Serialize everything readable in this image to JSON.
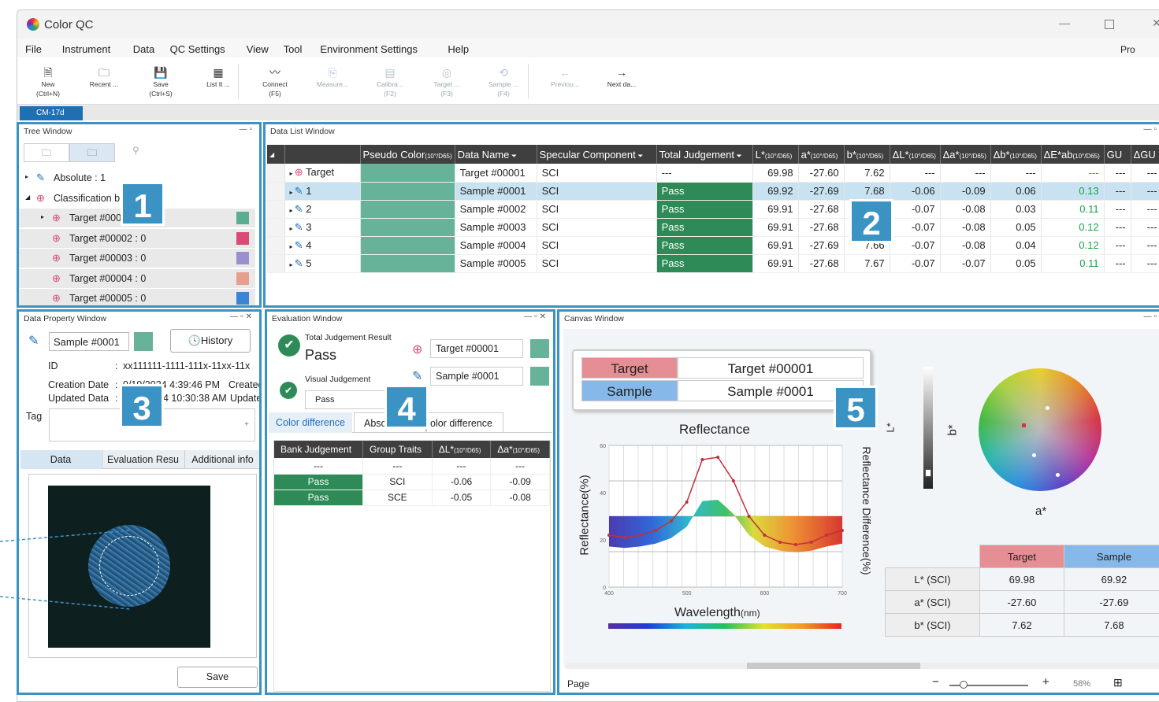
{
  "app": {
    "title": "Color QC",
    "pro_label": "Pro"
  },
  "menu": [
    "File",
    "Instrument",
    "Data",
    "QC Settings",
    "View",
    "Tool",
    "Environment Settings",
    "Help"
  ],
  "toolbar": [
    {
      "label": "New",
      "sub": "(Ctrl+N)",
      "icon": "new-file-icon",
      "glyph": "🗎",
      "enabled": true
    },
    {
      "label": "Recent ...",
      "sub": "",
      "icon": "recent-icon",
      "glyph": "🗀",
      "enabled": true
    },
    {
      "label": "Save",
      "sub": "(Ctrl+S)",
      "icon": "save-icon",
      "glyph": "💾",
      "enabled": true
    },
    {
      "label": "List It ...",
      "sub": "",
      "icon": "list-icon",
      "glyph": "▦",
      "enabled": true
    },
    {
      "label": "Connect",
      "sub": "(F5)",
      "icon": "connect-icon",
      "glyph": "〰",
      "enabled": true
    },
    {
      "label": "Measure...",
      "sub": "",
      "icon": "measure-icon",
      "glyph": "⎘",
      "enabled": false
    },
    {
      "label": "Calibra...",
      "sub": "(F2)",
      "icon": "calibrate-icon",
      "glyph": "▤",
      "enabled": false
    },
    {
      "label": "Target ...",
      "sub": "(F3)",
      "icon": "target-measure-icon",
      "glyph": "◎",
      "enabled": false
    },
    {
      "label": "Sample ...",
      "sub": "(F4)",
      "icon": "sample-measure-icon",
      "glyph": "⟲",
      "enabled": false
    },
    {
      "label": "Previou...",
      "sub": "",
      "icon": "previous-icon",
      "glyph": "←",
      "enabled": false
    },
    {
      "label": "Next da...",
      "sub": "",
      "icon": "next-icon",
      "glyph": "→",
      "enabled": true
    }
  ],
  "doc_tab": "CM-17d",
  "tree": {
    "title": "Tree Window",
    "rows": [
      {
        "label": "Absolute : 1",
        "icon": "probe-icon",
        "color": ""
      },
      {
        "label": "Classification b",
        "icon": "target-icon",
        "color": ""
      },
      {
        "label": "Target #000",
        "icon": "target-icon",
        "color": "#5aad8f"
      },
      {
        "label": "Target #00002 : 0",
        "icon": "target-icon",
        "color": "#d94a75"
      },
      {
        "label": "Target #00003 : 0",
        "icon": "target-icon",
        "color": "#9a8fcf"
      },
      {
        "label": "Target #00004 : 0",
        "icon": "target-icon",
        "color": "#e6a08f"
      },
      {
        "label": "Target #00005 : 0",
        "icon": "target-icon",
        "color": "#3a86d4"
      }
    ]
  },
  "datalist": {
    "title": "Data List Window",
    "headers": [
      "Pseudo Color",
      "Data Name",
      "Specular Component",
      "Total Judgement",
      "L*",
      "a*",
      "b*",
      "ΔL*",
      "Δa*",
      "Δb*",
      "ΔE*ab",
      "GU",
      "ΔGU"
    ],
    "illum": "(10°/D65)",
    "rows": [
      {
        "name": "Target #00001",
        "idx": "Target",
        "spec": "SCI",
        "judge": "---",
        "L": "69.98",
        "a": "-27.60",
        "b": "7.62",
        "dL": "---",
        "da": "---",
        "db": "---",
        "dE": "---",
        "gu": "---",
        "dgu": "---"
      },
      {
        "name": "Sample #0001",
        "idx": "1",
        "spec": "SCI",
        "judge": "Pass",
        "L": "69.92",
        "a": "-27.69",
        "b": "7.68",
        "dL": "-0.06",
        "da": "-0.09",
        "db": "0.06",
        "dE": "0.13",
        "gu": "---",
        "dgu": "---"
      },
      {
        "name": "Sample #0002",
        "idx": "2",
        "spec": "SCI",
        "judge": "Pass",
        "L": "69.91",
        "a": "-27.68",
        "b": "",
        "dL": "-0.07",
        "da": "-0.08",
        "db": "0.03",
        "dE": "0.11",
        "gu": "---",
        "dgu": "---"
      },
      {
        "name": "Sample #0003",
        "idx": "3",
        "spec": "SCI",
        "judge": "Pass",
        "L": "69.91",
        "a": "-27.68",
        "b": "",
        "dL": "-0.07",
        "da": "-0.08",
        "db": "0.05",
        "dE": "0.12",
        "gu": "---",
        "dgu": "---"
      },
      {
        "name": "Sample #0004",
        "idx": "4",
        "spec": "SCI",
        "judge": "Pass",
        "L": "69.91",
        "a": "-27.69",
        "b": "7.66",
        "dL": "-0.07",
        "da": "-0.08",
        "db": "0.04",
        "dE": "0.12",
        "gu": "---",
        "dgu": "---"
      },
      {
        "name": "Sample #0005",
        "idx": "5",
        "spec": "SCI",
        "judge": "Pass",
        "L": "69.91",
        "a": "-27.68",
        "b": "7.67",
        "dL": "-0.07",
        "da": "-0.07",
        "db": "0.05",
        "dE": "0.11",
        "gu": "---",
        "dgu": "---"
      }
    ]
  },
  "property": {
    "title": "Data Property Window",
    "name": "Sample #0001",
    "history": "History",
    "id_label": "ID",
    "id_value": "xx111111-1111-111x-11xx-11x",
    "created_label": "Creation Date",
    "created_value": "9/19/2024 4:39:46 PM",
    "created_extra": "Created",
    "updated_label": "Updated Data",
    "updated_value": "4 10:30:38 AM",
    "updated_extra": "Update",
    "tag_label": "Tag",
    "tabs": [
      "Data",
      "Evaluation Resu",
      "Additional info"
    ],
    "save": "Save"
  },
  "evaluation": {
    "title": "Evaluation Window",
    "total_label": "Total Judgement Result",
    "total_value": "Pass",
    "visual_label": "Visual Judgement",
    "visual_value": "Pass",
    "target": "Target #00001",
    "sample": "Sample #0001",
    "tabs": [
      "Color difference",
      "Abso",
      "olor difference"
    ],
    "headers": [
      "Bank Judgement",
      "Group Traits",
      "ΔL*",
      "Δa*"
    ],
    "rows": [
      [
        "---",
        "---",
        "---",
        "---"
      ],
      [
        "Pass",
        "SCI",
        "-0.06",
        "-0.09"
      ],
      [
        "Pass",
        "SCE",
        "-0.05",
        "-0.08"
      ]
    ]
  },
  "canvas": {
    "title": "Canvas Window",
    "legend_target_label": "Target",
    "legend_target_value": "Target #00001",
    "legend_sample_label": "Sample",
    "legend_sample_value": "Sample #0001",
    "graph_title": "Reflectance",
    "ylabel": "Reflectance(%)",
    "y2label": "Reflectance Difference(%)",
    "xlabel": "Wavelength",
    "xunit": "(nm)",
    "lstar": "L*",
    "bstar": "b*",
    "astar": "a*",
    "table_headers": [
      "Target",
      "Sample"
    ],
    "table_rows": [
      [
        "L* (SCI)",
        "69.98",
        "69.92"
      ],
      [
        "a* (SCI)",
        "-27.60",
        "-27.69"
      ],
      [
        "b* (SCI)",
        "7.62",
        "7.68"
      ]
    ],
    "zoom": "58%",
    "page_label": "Page"
  },
  "badges": [
    "1",
    "2",
    "3",
    "4",
    "5"
  ],
  "colors": {
    "accent": "#3b93c4",
    "pass": "#2e8b57",
    "pseudo": "#67b39a",
    "target_hdr": "#e58f95",
    "sample_hdr": "#86b8ea"
  },
  "chart_data": {
    "type": "line",
    "x": [
      400,
      420,
      440,
      460,
      480,
      500,
      520,
      540,
      560,
      580,
      600,
      620,
      640,
      660,
      680,
      700
    ],
    "series": [
      {
        "values": [
          22,
          21,
          22,
          24,
          28,
          36,
          54,
          55,
          45,
          30,
          22,
          19,
          18,
          19,
          22,
          24
        ]
      }
    ],
    "xlim": [
      400,
      700
    ],
    "ylim": [
      0,
      60
    ]
  }
}
